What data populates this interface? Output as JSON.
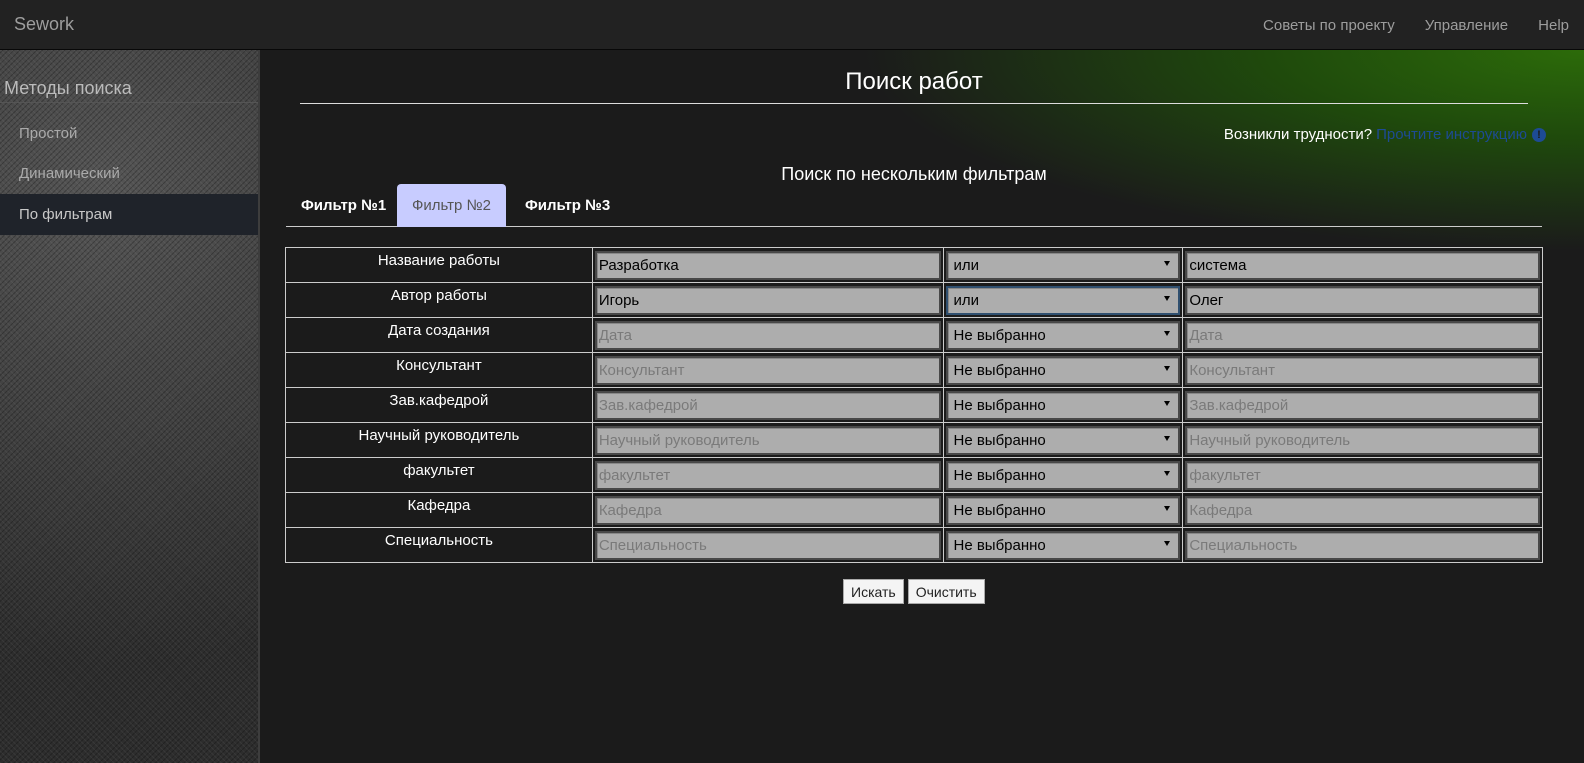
{
  "navbar": {
    "brand": "Sework",
    "links": [
      "Советы по проекту",
      "Управление",
      "Help"
    ]
  },
  "sidebar": {
    "title": "Методы поиска",
    "items": [
      {
        "label": "Простой",
        "active": false
      },
      {
        "label": "Динамический",
        "active": false
      },
      {
        "label": "По фильтрам",
        "active": true
      }
    ]
  },
  "main": {
    "title": "Поиск работ",
    "help_text": "Возникли трудности?",
    "help_link": "Прочтите инструкцию",
    "subtitle": "Поиск по нескольким фильтрам",
    "tabs": [
      {
        "label": "Фильтр №1",
        "active": false
      },
      {
        "label": "Фильтр №2",
        "active": true
      },
      {
        "label": "Фильтр №3",
        "active": false
      }
    ],
    "rows": [
      {
        "label": "Название работы",
        "value1": "Разработка",
        "placeholder1": "",
        "operator": "или",
        "value2": "система",
        "placeholder2": ""
      },
      {
        "label": "Автор работы",
        "value1": "Игорь",
        "placeholder1": "",
        "operator": "или",
        "value2": "Олег",
        "placeholder2": ""
      },
      {
        "label": "Дата создания",
        "value1": "",
        "placeholder1": "Дата",
        "operator": "Не выбранно",
        "value2": "",
        "placeholder2": "Дата"
      },
      {
        "label": "Консультант",
        "value1": "",
        "placeholder1": "Консультант",
        "operator": "Не выбранно",
        "value2": "",
        "placeholder2": "Консультант"
      },
      {
        "label": "Зав.кафедрой",
        "value1": "",
        "placeholder1": "Зав.кафедрой",
        "operator": "Не выбранно",
        "value2": "",
        "placeholder2": "Зав.кафедрой"
      },
      {
        "label": "Научный руководитель",
        "value1": "",
        "placeholder1": "Научный руководитель",
        "operator": "Не выбранно",
        "value2": "",
        "placeholder2": "Научный руководитель"
      },
      {
        "label": "факультет",
        "value1": "",
        "placeholder1": "факультет",
        "operator": "Не выбранно",
        "value2": "",
        "placeholder2": "факультет"
      },
      {
        "label": "Кафедра",
        "value1": "",
        "placeholder1": "Кафедра",
        "operator": "Не выбранно",
        "value2": "",
        "placeholder2": "Кафедра"
      },
      {
        "label": "Специальность",
        "value1": "",
        "placeholder1": "Специальность",
        "operator": "Не выбранно",
        "value2": "",
        "placeholder2": "Специальность"
      }
    ],
    "search_button": "Искать",
    "clear_button": "Очистить"
  },
  "colors": {
    "accent_green": "#2c6b0a",
    "active_tab": "#c8ccff",
    "link": "#1d4b94"
  }
}
